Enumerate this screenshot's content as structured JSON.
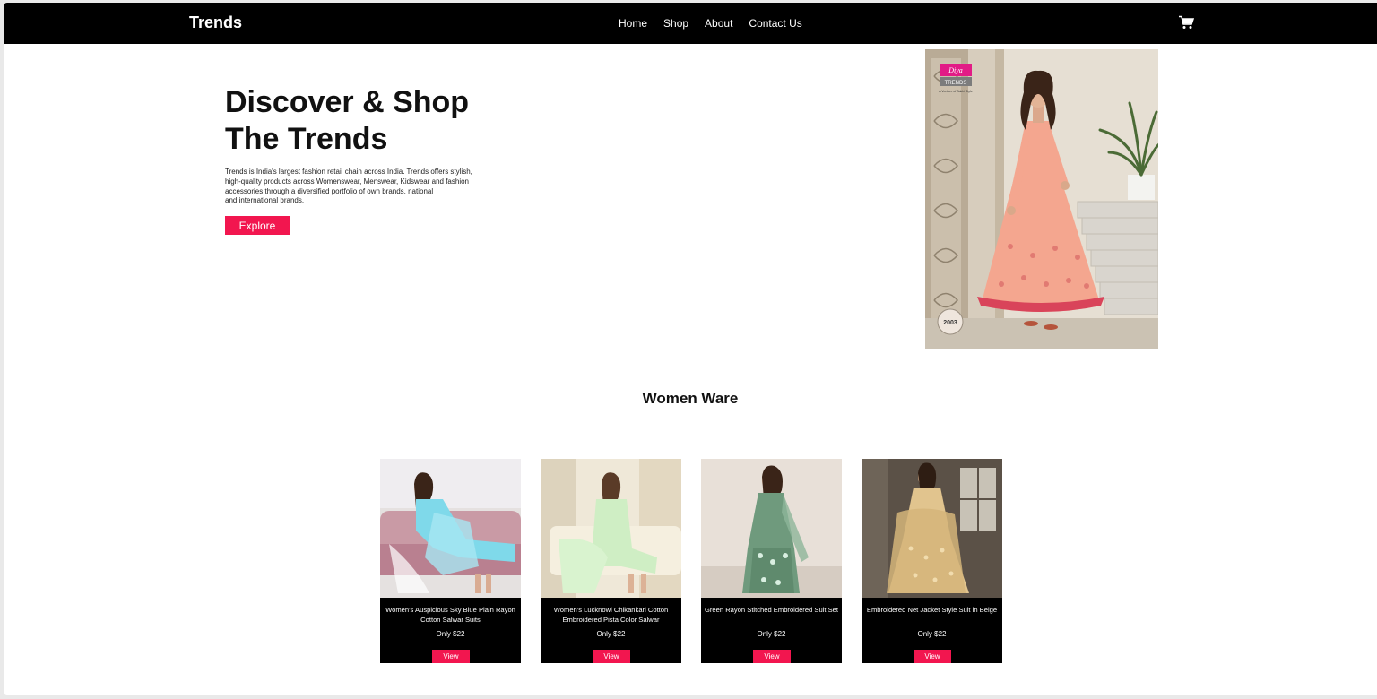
{
  "nav": {
    "brand": "Trends",
    "links": [
      "Home",
      "Shop",
      "About",
      "Contact Us"
    ],
    "cart_icon": "cart-icon"
  },
  "hero": {
    "title_lines": [
      "Discover & Shop",
      "The Trends"
    ],
    "description_lines": [
      "Trends is India's largest fashion retail chain across India. Trends offers stylish,",
      "high-quality products across Womenswear, Menswear, Kidswear and fashion",
      "accessories through a diversified portfolio of own brands, national",
      "and international brands."
    ],
    "button_label": "Explore",
    "image_badge": {
      "brand_mark": "Diya",
      "brand_label": "TRENDS",
      "tagline": "A Venture of Sakhi Style",
      "code": "2003"
    }
  },
  "section": {
    "title": "Women Ware"
  },
  "products": [
    {
      "name": "Women's Auspicious Sky Blue Plain Rayon Cotton Salwar Suits",
      "price": "Only $22",
      "button": "View"
    },
    {
      "name": "Women's Lucknowi Chikankari Cotton Embroidered Pista Color Salwar",
      "price": "Only $22",
      "button": "View"
    },
    {
      "name": "Green Rayon Stitched Embroidered Suit Set",
      "price": "Only $22",
      "button": "View"
    },
    {
      "name": "Embroidered Net Jacket Style Suit in Beige",
      "price": "Only $22",
      "button": "View"
    }
  ],
  "colors": {
    "accent": "#f2164f",
    "navbar": "#000000",
    "card": "#000000"
  }
}
